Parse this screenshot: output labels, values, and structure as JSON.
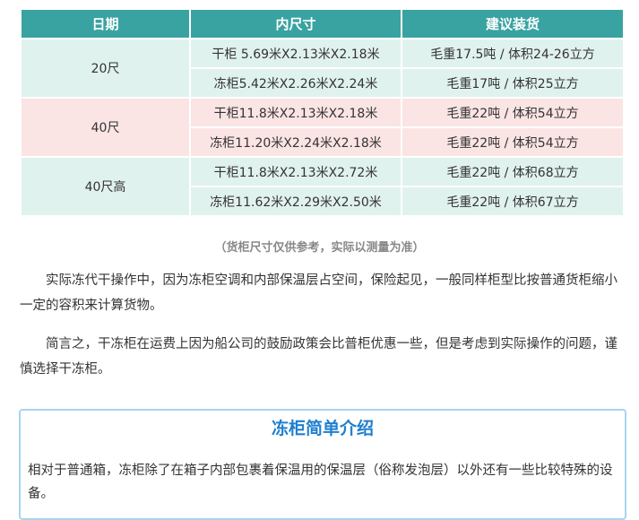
{
  "table": {
    "headers": [
      "日期",
      "内尺寸",
      "建议装货"
    ],
    "groups": [
      {
        "type": "20尺",
        "rows": [
          {
            "size": "干柜 5.69米X2.13米X2.18米",
            "load": "毛重17.5吨 / 体积24-26立方"
          },
          {
            "size": "冻柜5.42米X2.26米X2.24米",
            "load": "毛重17吨 / 体积25立方"
          }
        ]
      },
      {
        "type": "40尺",
        "rows": [
          {
            "size": "干柜11.8米X2.13米X2.18米",
            "load": "毛重22吨 / 体积54立方"
          },
          {
            "size": "冻柜11.20米X2.24米X2.18米",
            "load": "毛重22吨 / 体积54立方"
          }
        ]
      },
      {
        "type": "40尺高",
        "rows": [
          {
            "size": "干柜11.8米X2.13米X2.72米",
            "load": "毛重22吨 / 体积68立方"
          },
          {
            "size": "冻柜11.62米X2.29米X2.50米",
            "load": "毛重22吨 / 体积67立方"
          }
        ]
      }
    ],
    "colors": {
      "header": "#39a3a1",
      "group_1": "#e0f2ee",
      "group_2": "#fbe4e4",
      "group_3": "#e0f2ee"
    }
  },
  "caption": "（货柜尺寸仅供参考，实际以测量为准）",
  "paragraphs": [
    "实际冻代干操作中，因为冻柜空调和内部保温层占空间，保险起见，一般同样柜型比按普通货柜缩小一定的容积来计算货物。",
    "简言之，干冻柜在运费上因为船公司的鼓励政策会比普柜优惠一些，但是考虑到实际操作的问题，谨慎选择干冻柜。"
  ],
  "intro_box": {
    "title": "冻柜简单介绍",
    "text": "相对于普通箱，冻柜除了在箱子内部包裹着保温用的保温层（俗称发泡层）以外还有一些比较特殊的设备。"
  }
}
